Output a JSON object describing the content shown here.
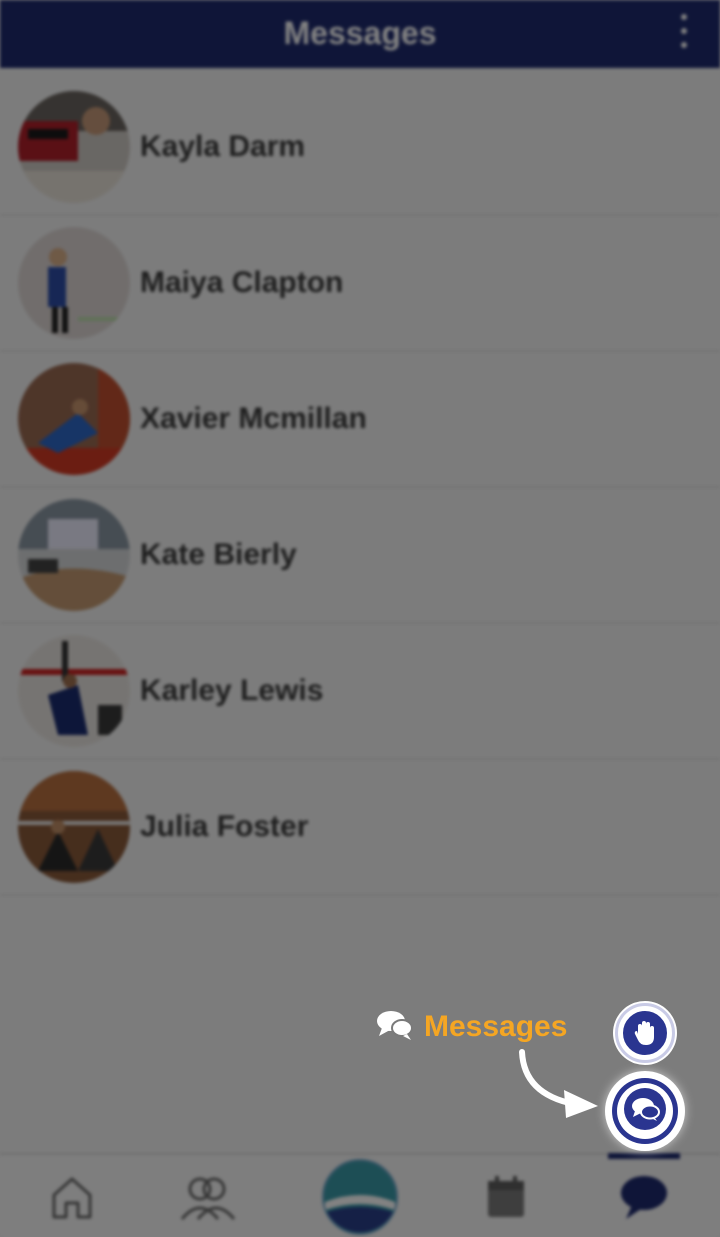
{
  "header": {
    "title": "Messages"
  },
  "contacts": [
    {
      "name": "Kayla Darm"
    },
    {
      "name": "Maiya Clapton"
    },
    {
      "name": "Xavier Mcmillan"
    },
    {
      "name": "Kate Bierly"
    },
    {
      "name": "Karley Lewis"
    },
    {
      "name": "Julia Foster"
    }
  ],
  "tabbar": {
    "tabs": [
      {
        "icon": "home-icon"
      },
      {
        "icon": "team-icon"
      },
      {
        "icon": "club-logo-icon"
      },
      {
        "icon": "calendar-icon"
      },
      {
        "icon": "chat-icon",
        "active": true
      }
    ]
  },
  "tooltip": {
    "label": "Messages"
  },
  "colors": {
    "header": "#1e2a6e",
    "accent": "#2a3590",
    "tooltip": "#f5a623"
  }
}
